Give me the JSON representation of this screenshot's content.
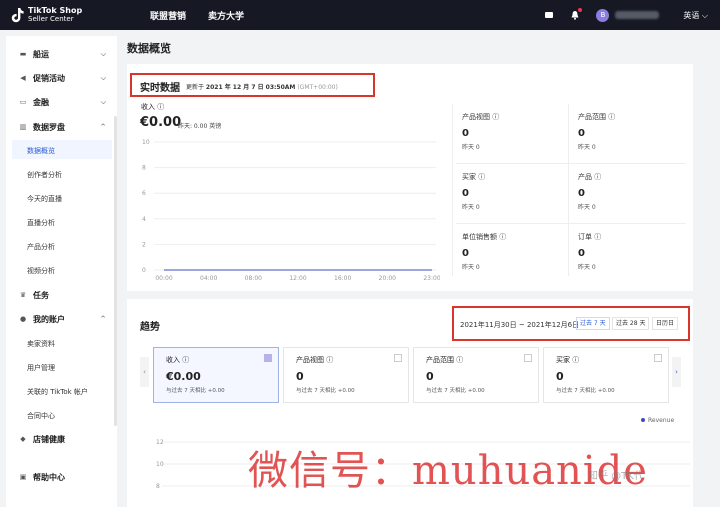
{
  "header": {
    "logo_line1": "TikTok Shop",
    "logo_line2": "Seller Center",
    "nav": [
      "联盟营销",
      "卖方大学"
    ],
    "language": "英语 ⌵",
    "avatar_letter": "B"
  },
  "sidebar": {
    "items": [
      {
        "label": "船运",
        "icon": "ship-icon",
        "chevron": "⌵"
      },
      {
        "label": "促销活动",
        "icon": "megaphone-icon",
        "chevron": "⌵"
      },
      {
        "label": "金融",
        "icon": "money-icon",
        "chevron": "⌵"
      },
      {
        "label": "数据罗盘",
        "icon": "compass-icon",
        "chevron": "^"
      }
    ],
    "data_sub": [
      "数据概览",
      "创作者分析",
      "今天的直播",
      "直播分析",
      "产品分析",
      "视频分析"
    ],
    "task": "任务",
    "account": "我的账户",
    "account_sub": [
      "卖家资料",
      "用户管理",
      "关联的 TikTok 帐户",
      "合同中心"
    ],
    "health": "店铺健康",
    "help": "帮助中心"
  },
  "page_title": "数据概览",
  "realtime": {
    "title": "实时数据",
    "updated_prefix": "更新于 ",
    "updated_time": "2021 年 12 月 7 日 03:50AM",
    "timezone": "(GMT+00:00)",
    "revenue_label": "收入 ⓘ",
    "revenue_value": "€0.00",
    "revenue_yesterday": "昨天: 0.00 英镑",
    "metrics": [
      {
        "label": "产品视图 ⓘ",
        "value": "0",
        "yesterday": "昨天 0"
      },
      {
        "label": "产品范围 ⓘ",
        "value": "0",
        "yesterday": "昨天 0"
      },
      {
        "label": "买家 ⓘ",
        "value": "0",
        "yesterday": "昨天 0"
      },
      {
        "label": "产品 ⓘ",
        "value": "0",
        "yesterday": "昨天 0"
      },
      {
        "label": "单位销售额 ⓘ",
        "value": "0",
        "yesterday": "昨天 0"
      },
      {
        "label": "订单 ⓘ",
        "value": "0",
        "yesterday": "昨天 0"
      }
    ]
  },
  "chart_data": {
    "type": "line",
    "x": [
      "00:00",
      "04:00",
      "08:00",
      "12:00",
      "16:00",
      "20:00",
      "23:00"
    ],
    "y_ticks": [
      0,
      2,
      4,
      6,
      8,
      10
    ],
    "ylim": [
      0,
      10
    ],
    "series": [
      {
        "values": [
          0,
          0,
          0,
          0,
          0,
          0,
          0
        ]
      }
    ],
    "title": "",
    "xlabel": "",
    "ylabel": "",
    "grid": true
  },
  "trends": {
    "title": "趋势",
    "date_range": "2021年11月30日 ~ 2021年12月6日",
    "buttons": [
      "过去 7 天",
      "过去 28 天",
      "日历日"
    ],
    "cards": [
      {
        "label": "收入 ⓘ",
        "value": "€0.00",
        "compare": "与过去 7 天相比 +0.00"
      },
      {
        "label": "产品视图 ⓘ",
        "value": "0",
        "compare": "与过去 7 天相比 +0.00"
      },
      {
        "label": "产品范围 ⓘ",
        "value": "0",
        "compare": "与过去 7 天相比 +0.00"
      },
      {
        "label": "买家 ⓘ",
        "value": "0",
        "compare": "与过去 7 天相比 +0.00"
      }
    ],
    "legend": "Revenue",
    "y_ticks": [
      "12",
      "10",
      "8"
    ]
  },
  "watermark": "微信号：muhuanide",
  "zhihu_mark": "知乎 @TK代"
}
